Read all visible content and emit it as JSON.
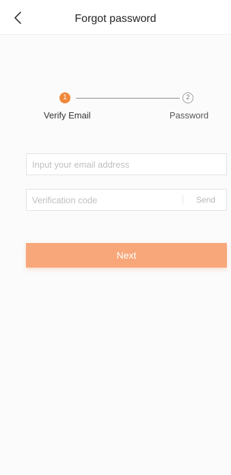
{
  "header": {
    "title": "Forgot password",
    "back_icon": "chevron-left-icon"
  },
  "stepper": {
    "steps": [
      {
        "number": "1",
        "label": "Verify Email",
        "state": "active"
      },
      {
        "number": "2",
        "label": "Password",
        "state": "inactive"
      }
    ]
  },
  "form": {
    "email_placeholder": "Input your email address",
    "email_value": "",
    "code_placeholder": "Verification code",
    "code_value": "",
    "send_label": "Send",
    "next_label": "Next"
  },
  "colors": {
    "accent": "#f0883a",
    "button": "#f8a77a",
    "background": "#fbfbfb"
  }
}
